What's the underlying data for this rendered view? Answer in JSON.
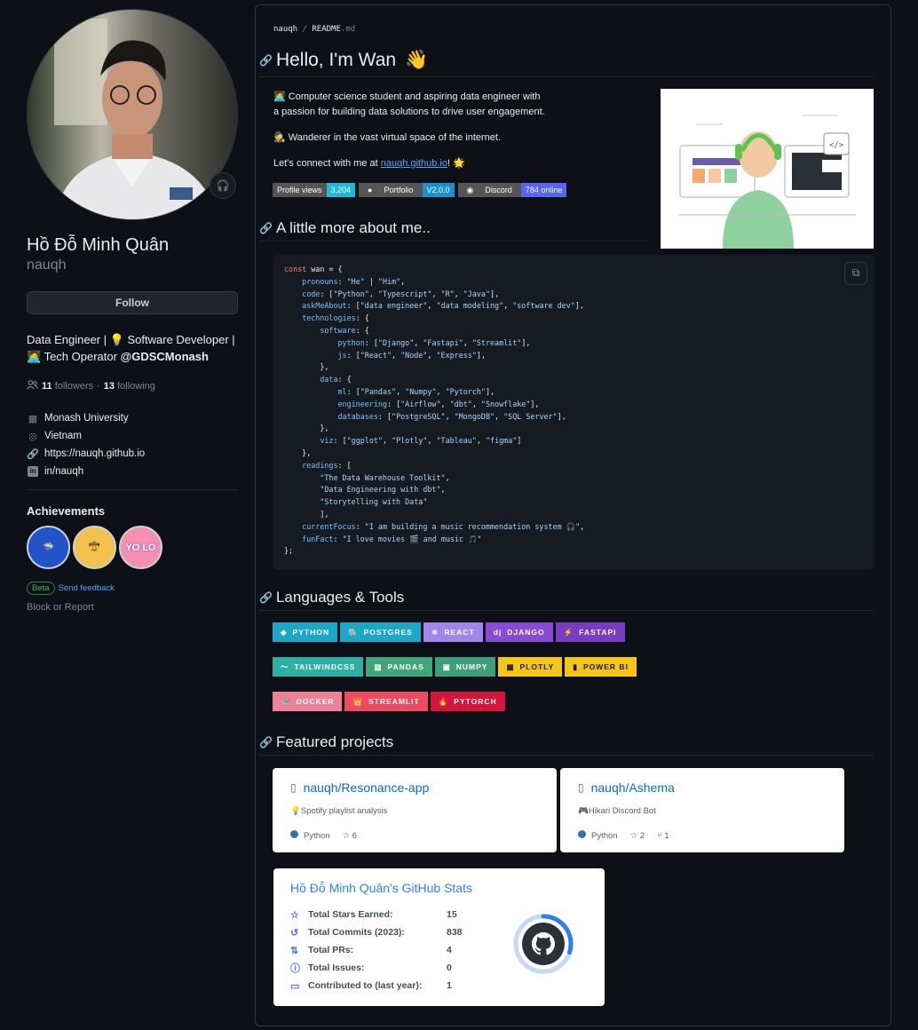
{
  "profile": {
    "fullname": "Hồ Đỗ Minh Quân",
    "username": "nauqh",
    "follow_label": "Follow",
    "bio_line1": "Data Engineer | 💡 Software Developer |",
    "bio_line2_prefix": "🧑‍💻 Tech Operator ",
    "bio_line2_org": "@GDSCMonash",
    "followers": "11",
    "followers_label": "followers",
    "following": "13",
    "following_label": "following",
    "company": "Monash University",
    "location": "Vietnam",
    "website": "https://nauqh.github.io",
    "linkedin": "in/nauqh",
    "achievements_title": "Achievements",
    "beta_label": "Beta",
    "feedback_label": "Send feedback",
    "block_label": "Block or Report"
  },
  "readme": {
    "crumb_user": "nauqh",
    "crumb_sep": " / ",
    "crumb_file": "README",
    "crumb_ext": ".md",
    "h1": "Hello, I'm Wan",
    "h1_emoji": "👋",
    "p1a": "🧑‍💻 Computer science student and aspiring data engineer with",
    "p1b": "a passion for building data solutions to drive user engagement.",
    "p2": "🕵️ Wanderer in the vast virtual space of the internet.",
    "p3_prefix": "Let's connect with me at ",
    "p3_link": "nauqh.github.io",
    "p3_suffix": "! 🌟",
    "shields": [
      {
        "label": "Profile views",
        "value": "3,204",
        "color": "#22b6d8"
      },
      {
        "label": "Portfolio",
        "value": "V2.0.0",
        "color": "#1e8fcf"
      },
      {
        "label": "Discord",
        "value": "784 online",
        "color": "#5865f2"
      }
    ],
    "h2_about": "A little more about me..",
    "h2_tools": "Languages & Tools",
    "h2_projects": "Featured projects"
  },
  "tools": [
    [
      {
        "label": "PYTHON",
        "color": "#1ba8c8",
        "icon": "◆"
      },
      {
        "label": "POSTGRES",
        "color": "#1ba8c8",
        "icon": "🐘"
      },
      {
        "label": "REACT",
        "color": "#9f86e8",
        "icon": "⚛"
      },
      {
        "label": "DJANGO",
        "color": "#8a4bd4",
        "icon": "dj"
      },
      {
        "label": "FASTAPI",
        "color": "#7a3cc2",
        "icon": "⚡"
      }
    ],
    [
      {
        "label": "TAILWINDCSS",
        "color": "#2bb0a3",
        "icon": "〜"
      },
      {
        "label": "PANDAS",
        "color": "#3fa67a",
        "icon": "▥"
      },
      {
        "label": "NUMPY",
        "color": "#3e9e79",
        "icon": "▣"
      },
      {
        "label": "PLOTLY",
        "color": "#f5c518",
        "icon": "▦"
      },
      {
        "label": "POWER BI",
        "color": "#f5c518",
        "icon": "▮"
      }
    ],
    [
      {
        "label": "DOCKER",
        "color": "#f07f98",
        "icon": "🐳"
      },
      {
        "label": "STREAMLIT",
        "color": "#ee4b62",
        "icon": "👑"
      },
      {
        "label": "PYTORCH",
        "color": "#d6153d",
        "icon": "🔥"
      }
    ]
  ],
  "projects": [
    {
      "name": "nauqh/Resonance-app",
      "desc": "💡Spotify playlist analysis",
      "lang": "Python",
      "stars": "6",
      "forks": ""
    },
    {
      "name": "nauqh/Ashema",
      "desc": "🎮Hikari Discord Bot",
      "lang": "Python",
      "stars": "2",
      "forks": "1"
    }
  ],
  "stats": {
    "title": "Hồ Đỗ Minh Quân's GitHub Stats",
    "rows": [
      {
        "label": "Total Stars Earned:",
        "value": "15",
        "icon": "☆"
      },
      {
        "label": "Total Commits (2023):",
        "value": "838",
        "icon": "↺"
      },
      {
        "label": "Total PRs:",
        "value": "4",
        "icon": "⇅"
      },
      {
        "label": "Total Issues:",
        "value": "0",
        "icon": "ⓘ"
      },
      {
        "label": "Contributed to (last year):",
        "value": "1",
        "icon": "▭"
      }
    ],
    "ring_fraction": 0.3
  }
}
